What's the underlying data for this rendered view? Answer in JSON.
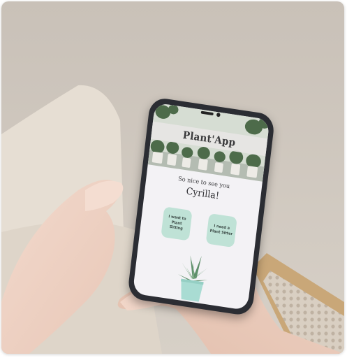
{
  "app": {
    "title": "Plant'App",
    "greeting": "So nice to see you",
    "user_name": "Cyrilla!"
  },
  "actions": [
    {
      "label_line1": "I want to",
      "label_line2": "Plant Sitting"
    },
    {
      "label_line1": "I need a",
      "label_line2": "Plant Sitter"
    }
  ],
  "colors": {
    "button_mint": "#bfe2d6",
    "pot_mint": "#a9dcd3",
    "phone_frame": "#2b2d33",
    "screen_bg": "#f3f2f5"
  }
}
